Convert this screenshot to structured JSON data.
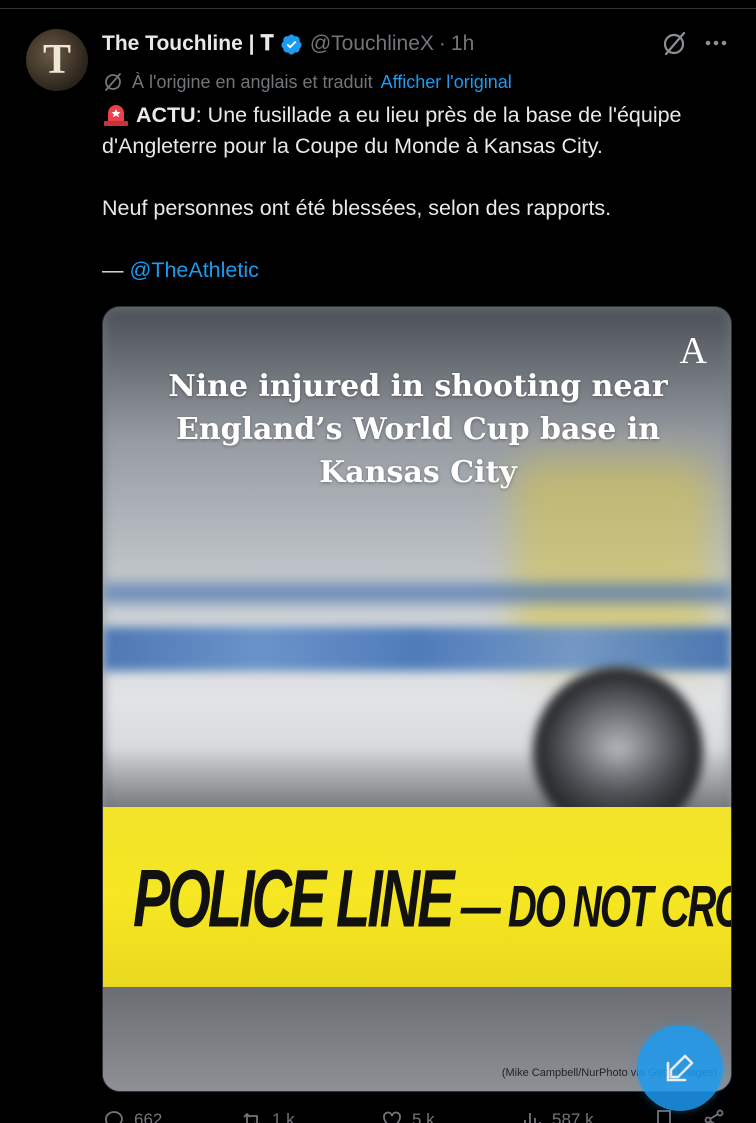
{
  "author": {
    "display_name": "The Touchline | 𝐓",
    "handle": "@TouchlineX",
    "separator": "·",
    "time": "1h",
    "avatar_letter": "T"
  },
  "translation": {
    "label": "À l'origine en anglais et traduit",
    "show_original": "Afficher l'original"
  },
  "tweet": {
    "lead": "ACTU",
    "line1_rest": ": Une fusillade a eu lieu près de la base de l'équipe d'Angleterre pour la Coupe du Monde à Kansas City.",
    "line2": "Neuf personnes ont été blessées, selon des rapports.",
    "attribution_dash": "— ",
    "mention": "@TheAthletic"
  },
  "media": {
    "logo": "A",
    "headline": "Nine injured in shooting near England’s World Cup base in Kansas City",
    "tape_part1": "POLICE LINE",
    "tape_part2": " — DO NOT CROSS",
    "credit": "(Mike Campbell/NurPhoto via Getty Images)"
  },
  "actions": {
    "replies": "662",
    "reposts": "1 k",
    "likes": "5 k",
    "views": "587 k"
  },
  "icons": {
    "verified": "verified-badge-icon",
    "grok": "grok-icon",
    "more": "more-icon",
    "translate": "translate-icon",
    "siren": "siren-icon",
    "compose": "compose-icon"
  },
  "colors": {
    "background": "#000000",
    "accent": "#1d9bf0",
    "secondary_text": "#71767b",
    "primary_text": "#e7e9ea"
  }
}
